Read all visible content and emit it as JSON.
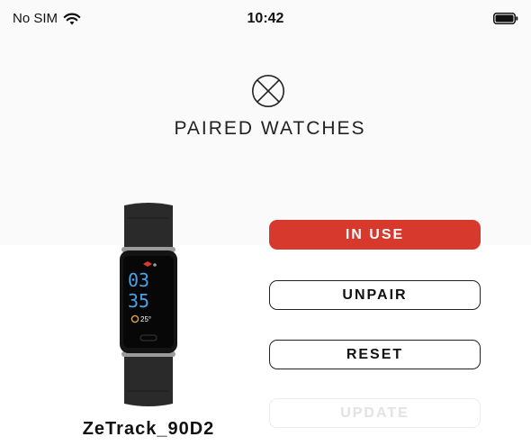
{
  "status_bar": {
    "carrier": "No SIM",
    "time": "10:42",
    "wifi_icon": "wifi-icon",
    "battery_icon": "battery-icon"
  },
  "header": {
    "close_icon": "close-circle-icon",
    "title": "PAIRED WATCHES"
  },
  "device": {
    "name": "ZeTrack_90D2",
    "screen": {
      "hour": "03",
      "minute": "35",
      "temperature": "25°"
    }
  },
  "actions": {
    "in_use_label": "IN USE",
    "unpair_label": "UNPAIR",
    "reset_label": "RESET",
    "update_label": "UPDATE"
  },
  "colors": {
    "accent": "#d8392d",
    "disabled_text": "#e2e2e2"
  }
}
